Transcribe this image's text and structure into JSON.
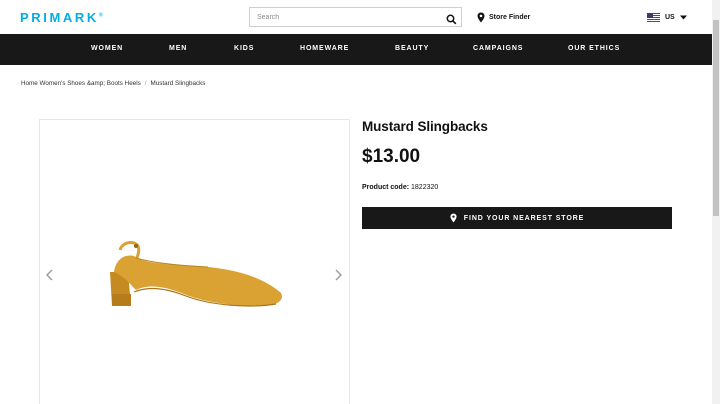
{
  "header": {
    "logo_text": "PRIMARK",
    "logo_mark": "®",
    "search_placeholder": "Search",
    "store_finder_label": "Store Finder",
    "locale_label": "US"
  },
  "nav": {
    "items": [
      {
        "label": "WOMEN"
      },
      {
        "label": "MEN"
      },
      {
        "label": "KIDS"
      },
      {
        "label": "HOMEWARE"
      },
      {
        "label": "BEAUTY"
      },
      {
        "label": "CAMPAIGNS"
      },
      {
        "label": "OUR ETHICS"
      }
    ]
  },
  "breadcrumb": {
    "home": "Home",
    "category": "Women's Shoes &amp; Boots",
    "subcategory": "Heels",
    "current": "Mustard Slingbacks",
    "separator": "/"
  },
  "product": {
    "title": "Mustard Slingbacks",
    "price": "$13.00",
    "code_label": "Product code:",
    "code_value": "1822320",
    "find_store_label": "FIND YOUR NEAREST STORE"
  },
  "colors": {
    "brand": "#00aee6",
    "nav_bg": "#181818",
    "shoe": "#d9a233"
  }
}
